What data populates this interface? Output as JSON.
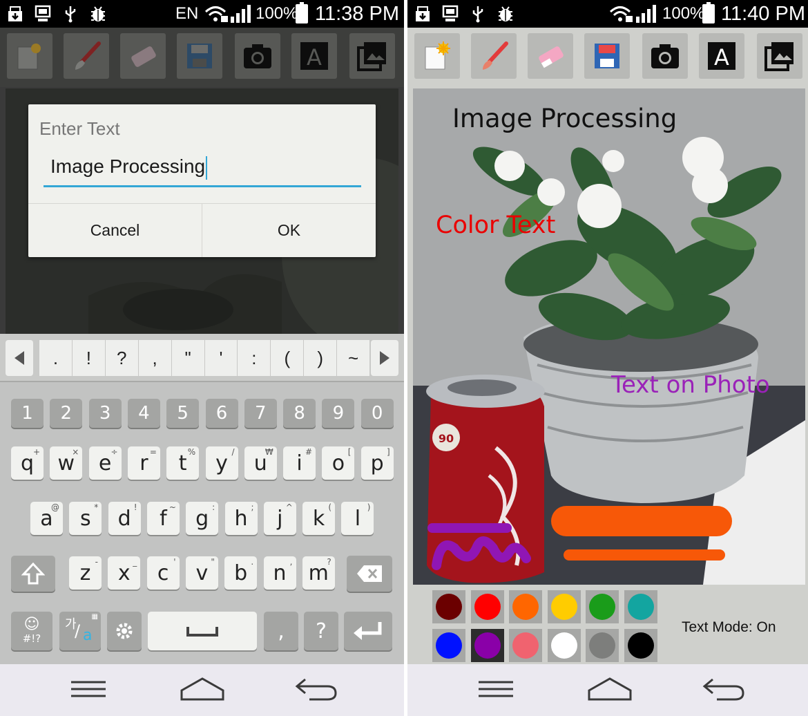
{
  "left": {
    "status": {
      "lang": "EN",
      "battery": "100%",
      "time": "11:38 PM"
    },
    "dialog": {
      "title": "Enter Text",
      "input_value": "Image Processing",
      "cancel_label": "Cancel",
      "ok_label": "OK"
    },
    "keyboard": {
      "symbols": [
        ".",
        "!",
        "?",
        ",",
        "\"",
        "'",
        ":",
        "(",
        ")",
        "~"
      ],
      "numbers": [
        "1",
        "2",
        "3",
        "4",
        "5",
        "6",
        "7",
        "8",
        "9",
        "0"
      ],
      "row1": [
        {
          "k": "q",
          "h": "+"
        },
        {
          "k": "w",
          "h": "×"
        },
        {
          "k": "e",
          "h": "÷"
        },
        {
          "k": "r",
          "h": "="
        },
        {
          "k": "t",
          "h": "%"
        },
        {
          "k": "y",
          "h": "/"
        },
        {
          "k": "u",
          "h": "₩"
        },
        {
          "k": "i",
          "h": "#"
        },
        {
          "k": "o",
          "h": "["
        },
        {
          "k": "p",
          "h": "]"
        }
      ],
      "row2": [
        {
          "k": "a",
          "h": "@"
        },
        {
          "k": "s",
          "h": "*"
        },
        {
          "k": "d",
          "h": "!"
        },
        {
          "k": "f",
          "h": "~"
        },
        {
          "k": "g",
          "h": ":"
        },
        {
          "k": "h",
          "h": ";"
        },
        {
          "k": "j",
          "h": "^"
        },
        {
          "k": "k",
          "h": "("
        },
        {
          "k": "l",
          "h": ")"
        }
      ],
      "row3": [
        {
          "k": "z",
          "h": "-"
        },
        {
          "k": "x",
          "h": "_"
        },
        {
          "k": "c",
          "h": "'"
        },
        {
          "k": "v",
          "h": "\""
        },
        {
          "k": "b",
          "h": "."
        },
        {
          "k": "n",
          "h": ","
        },
        {
          "k": "m",
          "h": "?"
        }
      ],
      "emoji_label": "#!?",
      "lang_label_top": "가",
      "lang_label_bottom": "a",
      "comma_label": ",",
      "question_label": "?"
    }
  },
  "right": {
    "status": {
      "battery": "100%",
      "time": "11:40 PM"
    },
    "overlays": {
      "title": "Image Processing",
      "color_text": "Color Text",
      "photo_text": "Text on Photo",
      "can_label": "90"
    },
    "palette": [
      "#6b0000",
      "#ff0000",
      "#ff6600",
      "#ffcc00",
      "#1a9c1a",
      "#13a5a0",
      "#0011ff",
      "#8a00a8",
      "#f0636f",
      "#ffffff",
      "#7d7e7c",
      "#000000"
    ],
    "selected_color_index": 7,
    "mode_label": "Text Mode: On"
  },
  "icons": [
    "download-icon",
    "monitor-icon",
    "usb-icon",
    "bug-icon",
    "wifi-lock-icon",
    "signal-icon",
    "battery-charging-icon",
    "new-page-icon",
    "brush-icon",
    "eraser-icon",
    "save-icon",
    "camera-icon",
    "text-icon",
    "gallery-icon",
    "menu-icon",
    "home-icon",
    "back-icon"
  ]
}
